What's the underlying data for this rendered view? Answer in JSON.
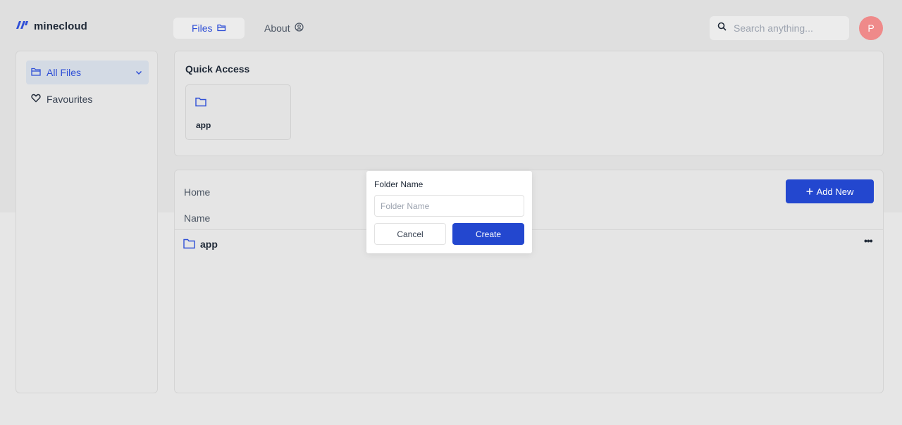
{
  "app": {
    "name": "minecloud"
  },
  "nav": {
    "tabs": [
      {
        "label": "Files",
        "icon": "folder-open-icon",
        "active": true
      },
      {
        "label": "About",
        "icon": "user-circle-icon",
        "active": false
      }
    ]
  },
  "search": {
    "placeholder": "Search anything..."
  },
  "user": {
    "avatar_initial": "P"
  },
  "sidebar": {
    "items": [
      {
        "label": "All Files",
        "icon": "folder-icon",
        "active": true
      },
      {
        "label": "Favourites",
        "icon": "heart-icon",
        "active": false
      }
    ]
  },
  "quick_access": {
    "title": "Quick Access",
    "items": [
      {
        "name": "app",
        "icon": "folder-icon"
      }
    ]
  },
  "files": {
    "breadcrumb": "Home",
    "add_label": "Add New",
    "column_name": "Name",
    "rows": [
      {
        "name": "app",
        "icon": "folder-icon"
      }
    ]
  },
  "modal": {
    "title": "Folder Name",
    "input_placeholder": "Folder Name",
    "cancel_label": "Cancel",
    "create_label": "Create"
  },
  "colors": {
    "accent": "#2347cf",
    "accent_text": "#2f4fd6",
    "avatar": "#ef8a8a"
  }
}
